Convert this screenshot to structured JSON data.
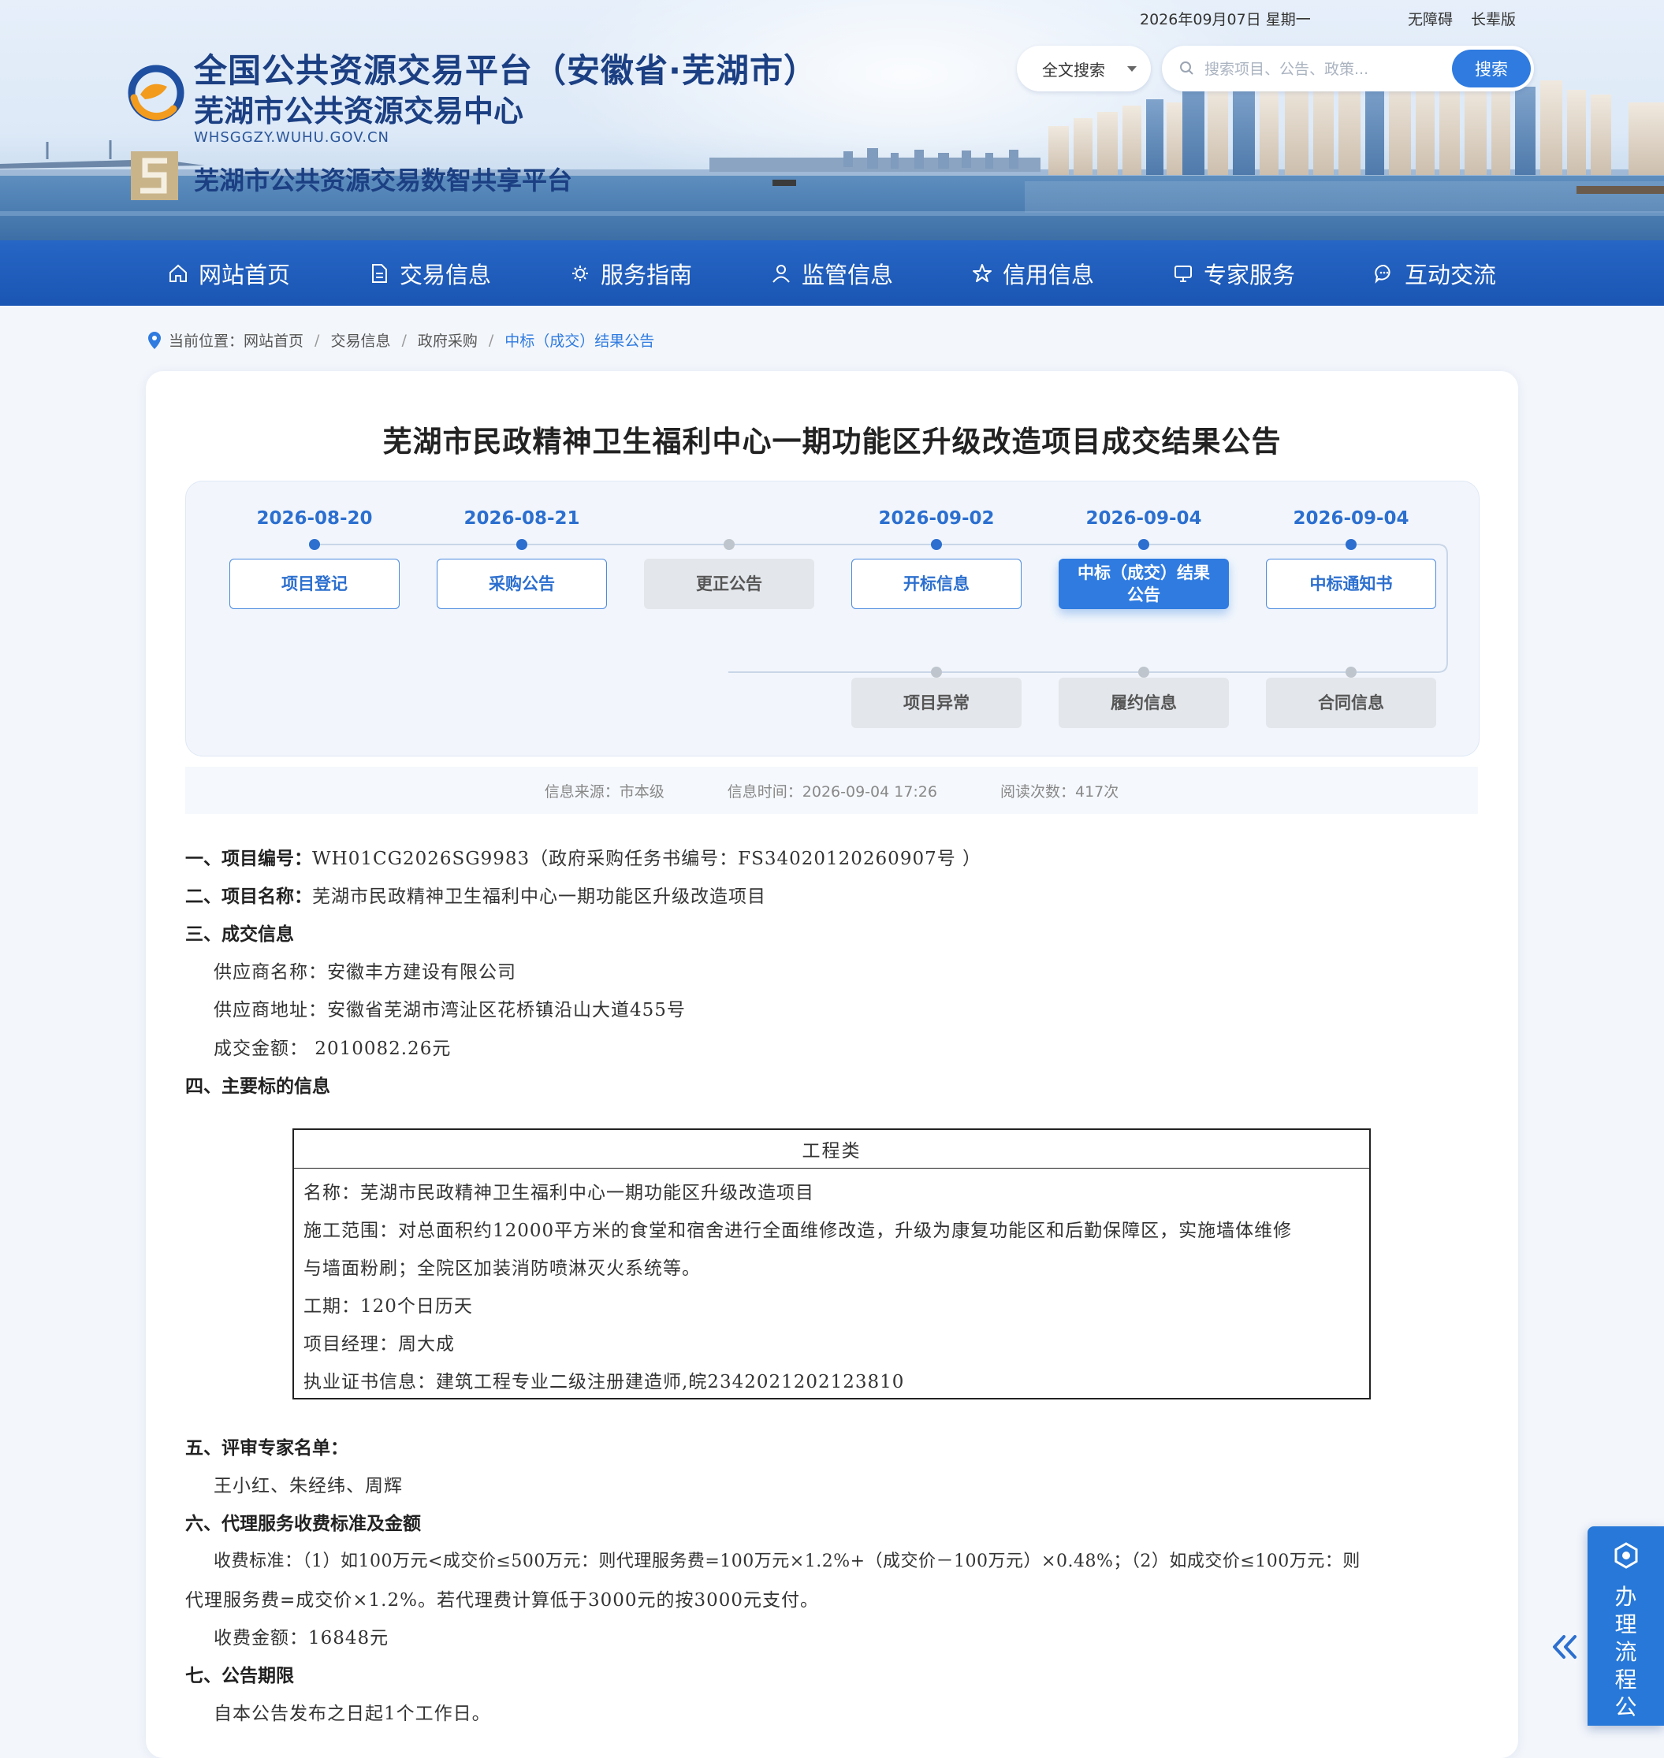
{
  "header": {
    "date": "2026年09月07日 星期一",
    "links": [
      "无障碍",
      "长辈版"
    ],
    "title_line1": "全国公共资源交易平台（安徽省·芜湖市）",
    "title_line2": "芜湖市公共资源交易中心",
    "domain": "WHSGGZY.WUHU.GOV.CN",
    "title_line3": "芜湖市公共资源交易数智共享平台",
    "search_type": "全文搜索",
    "search_placeholder": "搜索项目、公告、政策...",
    "search_button": "搜索"
  },
  "nav": [
    {
      "label": "网站首页",
      "icon": "home-icon"
    },
    {
      "label": "交易信息",
      "icon": "document-icon"
    },
    {
      "label": "服务指南",
      "icon": "service-icon"
    },
    {
      "label": "监管信息",
      "icon": "user-icon"
    },
    {
      "label": "信用信息",
      "icon": "star-icon"
    },
    {
      "label": "专家服务",
      "icon": "monitor-icon"
    },
    {
      "label": "互动交流",
      "icon": "chat-icon"
    }
  ],
  "breadcrumb": {
    "prefix": "当前位置：",
    "items": [
      "网站首页",
      "交易信息",
      "政府采购",
      "中标（成交）结果公告"
    ]
  },
  "doc": {
    "title": "芜湖市民政精神卫生福利中心一期功能区升级改造项目成交结果公告"
  },
  "flow": {
    "steps": [
      {
        "date": "2026-08-20",
        "label": "项目登记",
        "state": "on"
      },
      {
        "date": "2026-08-21",
        "label": "采购公告",
        "state": "on"
      },
      {
        "date": "",
        "label": "更正公告",
        "state": "off"
      },
      {
        "date": "2026-09-02",
        "label": "开标信息",
        "state": "on"
      },
      {
        "date": "2026-09-04",
        "label": "中标（成交）结果公告",
        "state": "active"
      },
      {
        "date": "2026-09-04",
        "label": "中标通知书",
        "state": "on"
      }
    ],
    "branch": [
      {
        "label": "项目异常",
        "state": "off"
      },
      {
        "label": "履约信息",
        "state": "off"
      },
      {
        "label": "合同信息",
        "state": "off"
      }
    ]
  },
  "meta": {
    "source": "信息来源：市本级",
    "time": "信息时间：2026-09-04 17:26",
    "views": "阅读次数：417次"
  },
  "content": {
    "s1_label": "一、项目编号：",
    "s1_value": "WH01CG2026SG9983（政府采购任务书编号：FS34020120260907号 ）",
    "s2_label": "二、项目名称：",
    "s2_value": "芜湖市民政精神卫生福利中心一期功能区升级改造项目",
    "s3_label": "三、成交信息",
    "supplier_name": "供应商名称：安徽丰方建设有限公司",
    "supplier_addr": "供应商地址：安徽省芜湖市湾沚区花桥镇沿山大道455号",
    "amount": "成交金额：  2010082.26元",
    "s4_label": "四、主要标的信息",
    "table": {
      "header": "工程类",
      "name": "名称：芜湖市民政精神卫生福利中心一期功能区升级改造项目",
      "scope1": "施工范围：对总面积约12000平方米的食堂和宿舍进行全面维修改造，升级为康复功能区和后勤保障区，实施墙体维修",
      "scope2": "与墙面粉刷；全院区加装消防喷淋灭火系统等。",
      "duration": "工期：120个日历天",
      "manager": "项目经理：周大成",
      "cert": "执业证书信息：建筑工程专业二级注册建造师,皖2342021202123810"
    },
    "s5_label": "五、评审专家名单：",
    "experts": "王小红、朱经纬、周辉",
    "s6_label": "六、代理服务收费标准及金额",
    "fee1": "收费标准：（1）如100万元<成交价≤500万元：则代理服务费=100万元×1.2%+（成交价－100万元）×0.48%；（2）如成交价≤100万元：则",
    "fee2": "代理服务费=成交价×1.2%。若代理费计算低于3000元的按3000元支付。",
    "fee_amount": "收费金额：16848元",
    "s7_label": "七、公告期限",
    "period": "自本公告发布之日起1个工作日。"
  },
  "float": {
    "label": "办理流程公"
  }
}
